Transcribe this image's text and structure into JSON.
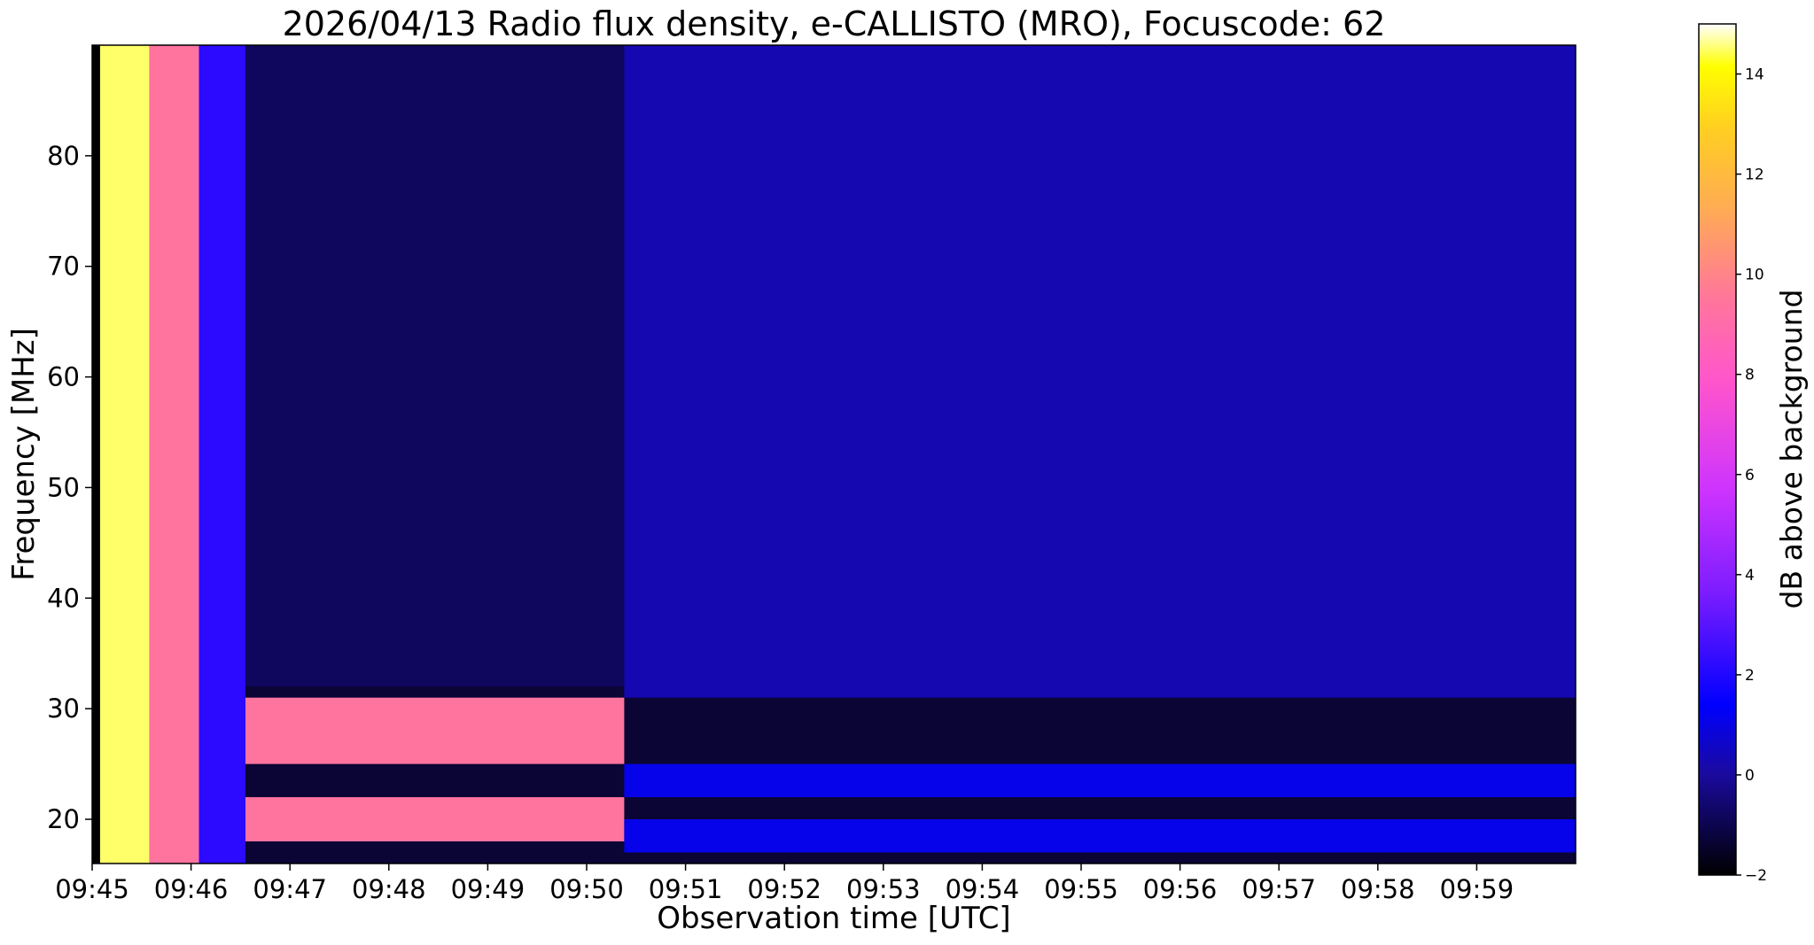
{
  "chart_data": {
    "type": "heatmap",
    "title": "2026/04/13  Radio flux density, e-CALLISTO (MRO), Focuscode: 62",
    "xlabel": "Observation time [UTC]",
    "ylabel": "Frequency [MHz]",
    "x_ticks": [
      "09:45",
      "09:46",
      "09:47",
      "09:48",
      "09:49",
      "09:50",
      "09:51",
      "09:52",
      "09:53",
      "09:54",
      "09:55",
      "09:56",
      "09:57",
      "09:58",
      "09:59"
    ],
    "xlim_minutes": [
      0,
      15
    ],
    "y_ticks": [
      20,
      30,
      40,
      50,
      60,
      70,
      80
    ],
    "ylim": [
      16,
      90
    ],
    "colorbar": {
      "label": "dB above background",
      "ticks": [
        -2,
        0,
        2,
        4,
        6,
        8,
        10,
        12,
        14
      ],
      "range": [
        -2,
        15
      ],
      "colormap": [
        "#000000",
        "#1a0aa0",
        "#0000ff",
        "#7a1cff",
        "#cc33ff",
        "#ff55cc",
        "#ff7799",
        "#ffaa55",
        "#ffd020",
        "#ffff00",
        "#ffffff"
      ]
    },
    "regions": [
      {
        "t": [
          0.0,
          0.08
        ],
        "f": [
          16,
          90
        ],
        "db": -2
      },
      {
        "t": [
          0.08,
          0.58
        ],
        "f": [
          16,
          90
        ],
        "db": 14
      },
      {
        "t": [
          0.58,
          1.08
        ],
        "f": [
          16,
          90
        ],
        "db": 8
      },
      {
        "t": [
          1.08,
          1.55
        ],
        "f": [
          16,
          90
        ],
        "db": 2
      },
      {
        "t": [
          1.55,
          5.38
        ],
        "f": [
          32,
          90
        ],
        "db": -1
      },
      {
        "t": [
          1.55,
          5.38
        ],
        "f": [
          25,
          31
        ],
        "db": 8
      },
      {
        "t": [
          1.55,
          5.38
        ],
        "f": [
          18,
          22
        ],
        "db": 8
      },
      {
        "t": [
          5.38,
          15.0
        ],
        "f": [
          31,
          90
        ],
        "db": 0
      },
      {
        "t": [
          5.38,
          15.0
        ],
        "f": [
          22,
          25
        ],
        "db": 1
      },
      {
        "t": [
          5.38,
          15.0
        ],
        "f": [
          17,
          20
        ],
        "db": 1
      }
    ]
  }
}
